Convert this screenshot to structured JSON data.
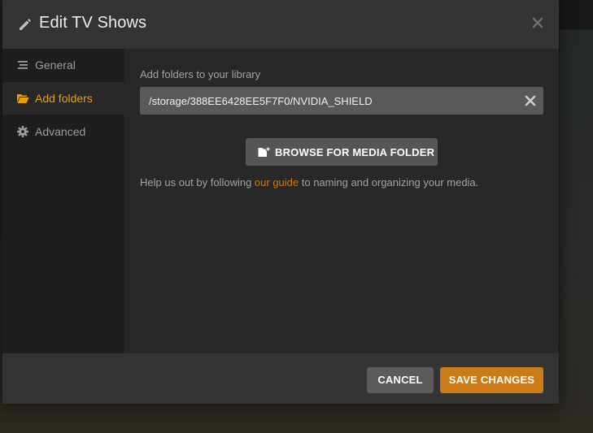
{
  "modal": {
    "title": "Edit TV Shows",
    "header_icon": "pencil-icon",
    "close_icon": "close-icon"
  },
  "sidebar": {
    "items": [
      {
        "label": "General",
        "icon": "list-icon",
        "active": false
      },
      {
        "label": "Add folders",
        "icon": "folder-open-icon",
        "active": true
      },
      {
        "label": "Advanced",
        "icon": "gear-icon",
        "active": false
      }
    ]
  },
  "content": {
    "section_label": "Add folders to your library",
    "folder_path": "/storage/388EE6428EE5F7F0/NVIDIA_SHIELD",
    "browse_label": "BROWSE FOR MEDIA FOLDER",
    "help_prefix": "Help us out by following ",
    "help_link": "our guide",
    "help_suffix": " to naming and organizing your media."
  },
  "footer": {
    "cancel_label": "CANCEL",
    "save_label": "SAVE CHANGES"
  },
  "colors": {
    "accent": "#e5a00d",
    "save_button": "#cc7b19",
    "link": "#cc7b19"
  }
}
